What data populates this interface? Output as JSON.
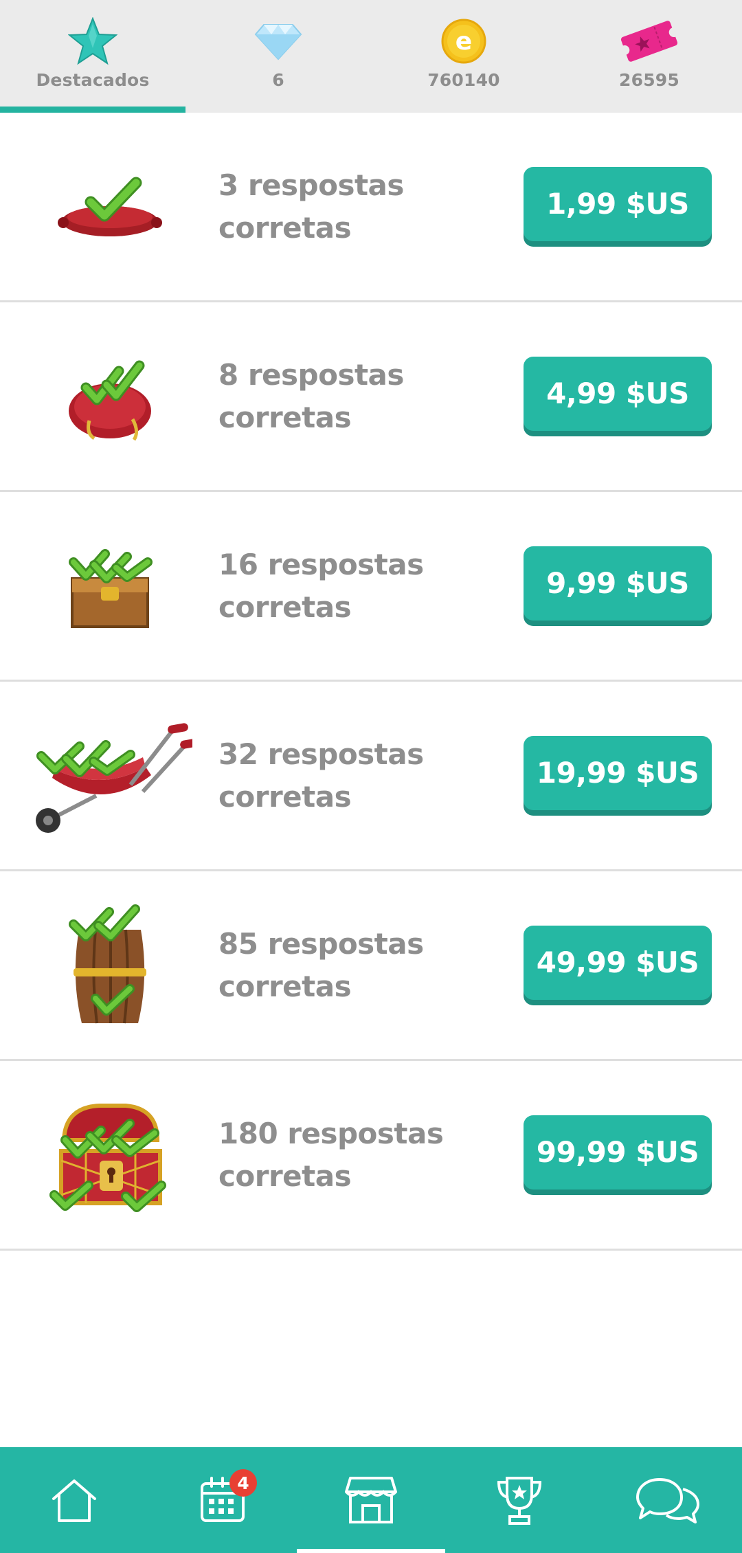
{
  "currency_bar": {
    "tabs": [
      {
        "label": "Destacados",
        "icon": "star-icon",
        "active": true
      },
      {
        "label": "6",
        "icon": "diamond-icon"
      },
      {
        "label": "760140",
        "icon": "coin-icon"
      },
      {
        "label": "26595",
        "icon": "ticket-icon"
      }
    ],
    "accent_color": "#24b3a0"
  },
  "products": [
    {
      "title": "3 respostas corretas",
      "price": "1,99 $US",
      "icon": "cushion-icon"
    },
    {
      "title": "8 respostas corretas",
      "price": "4,99 $US",
      "icon": "sack-icon"
    },
    {
      "title": "16 respostas corretas",
      "price": "9,99 $US",
      "icon": "crate-icon"
    },
    {
      "title": "32 respostas corretas",
      "price": "19,99 $US",
      "icon": "wheelbarrow-icon"
    },
    {
      "title": "85 respostas corretas",
      "price": "49,99 $US",
      "icon": "barrel-icon"
    },
    {
      "title": "180 respostas corretas",
      "price": "99,99 $US",
      "icon": "treasure-chest-icon"
    }
  ],
  "bottom_nav": {
    "items": [
      {
        "icon": "home-icon"
      },
      {
        "icon": "calendar-icon",
        "badge": "4"
      },
      {
        "icon": "shop-icon",
        "active": true
      },
      {
        "icon": "trophy-icon"
      },
      {
        "icon": "chat-icon"
      }
    ],
    "bar_color": "#25b6a4",
    "badge_color": "#e84033"
  }
}
